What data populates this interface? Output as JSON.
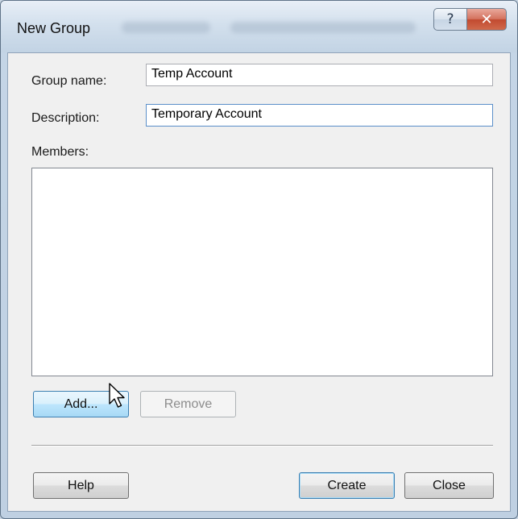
{
  "window": {
    "title": "New Group",
    "help_glyph": "?",
    "close_glyph": "✕"
  },
  "form": {
    "group_name_label": "Group name:",
    "group_name_value": "Temp Account",
    "description_label": "Description:",
    "description_value": "Temporary Account",
    "members_label": "Members:",
    "members": []
  },
  "buttons": {
    "add_label": "Add...",
    "remove_label": "Remove",
    "help_label": "Help",
    "create_label": "Create",
    "close_label": "Close"
  },
  "icons": [
    "help-icon",
    "close-icon",
    "mouse-cursor-icon"
  ]
}
